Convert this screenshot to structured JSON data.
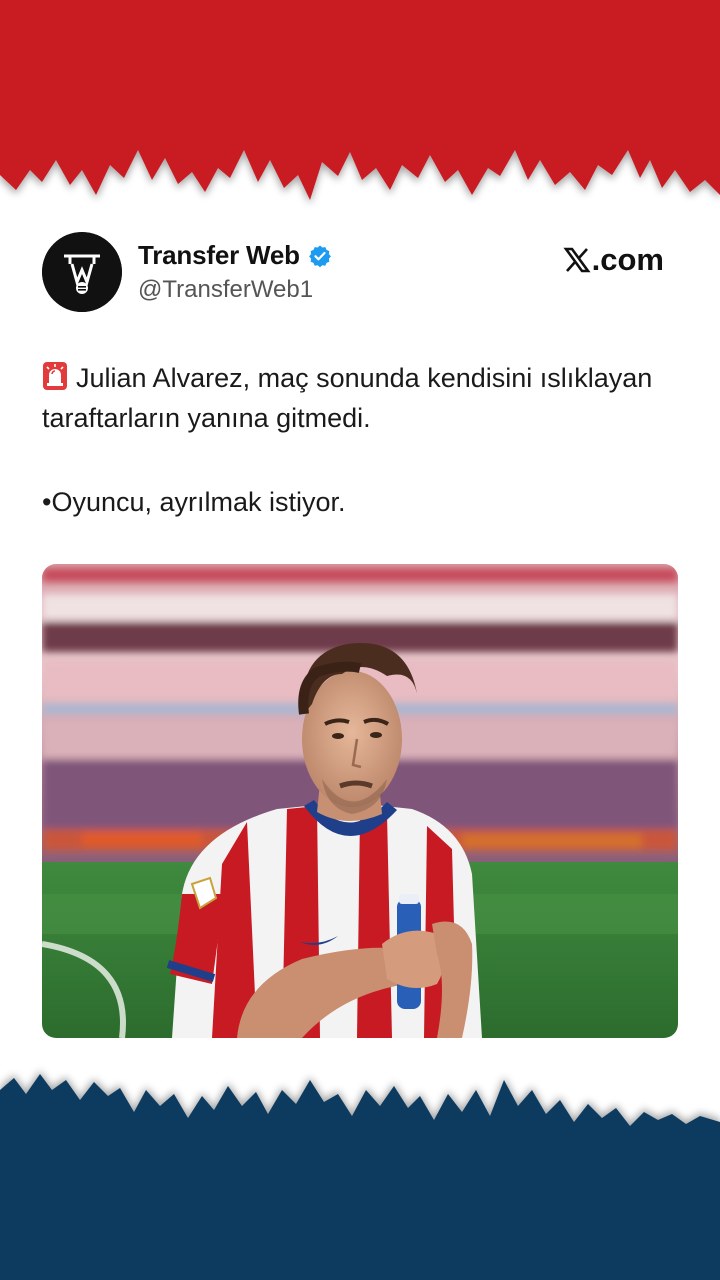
{
  "tweet": {
    "author_name": "Transfer Web",
    "author_handle": "@TransferWeb1",
    "source_label": ".com",
    "text_line1": "Julian Alvarez, maç sonunda kendisini ıslıklayan taraftarların yanına gitmedi.",
    "text_line2": "•Oyuncu, ayrılmak istiyor.",
    "alert_icon": "police-siren-icon",
    "verified_icon": "verified-badge-icon",
    "verified_color": "#1d9bf0"
  },
  "colors": {
    "top_band": "#c81a22",
    "bottom_band": "#0c3a5e",
    "background": "#ffffff"
  },
  "photo": {
    "subject": "football-player-photo"
  }
}
